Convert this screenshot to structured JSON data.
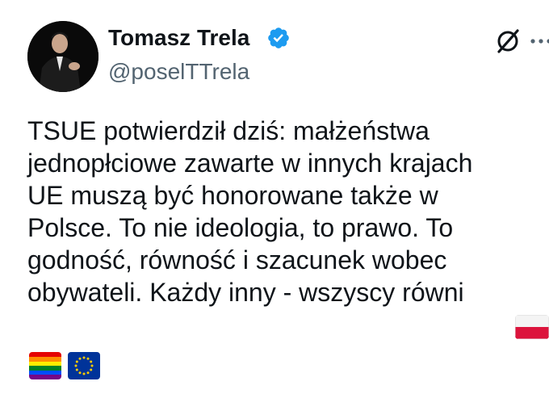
{
  "post": {
    "author": {
      "display_name": "Tomasz Trela",
      "handle": "@poselTTrela",
      "verified_color": "#1d9bf0"
    },
    "text_lines": [
      "TSUE potwierdził dziś: małżeństwa",
      "jednopłciowe zawarte w innych krajach",
      "UE muszą być honorowane także w",
      "Polsce. To nie ideologia, to prawo. To",
      "godność, równość i szacunek wobec",
      "obywateli. Każdy inny - wszyscy równi"
    ],
    "emojis": [
      "flag-poland",
      "rainbow-flag",
      "flag-eu"
    ]
  },
  "icons": {
    "verified": "verified-badge-icon",
    "grok": "grok-icon",
    "more": "more-options-icon"
  },
  "colors": {
    "text": "#0f1419",
    "secondary_text": "#536471",
    "background": "#ffffff"
  }
}
